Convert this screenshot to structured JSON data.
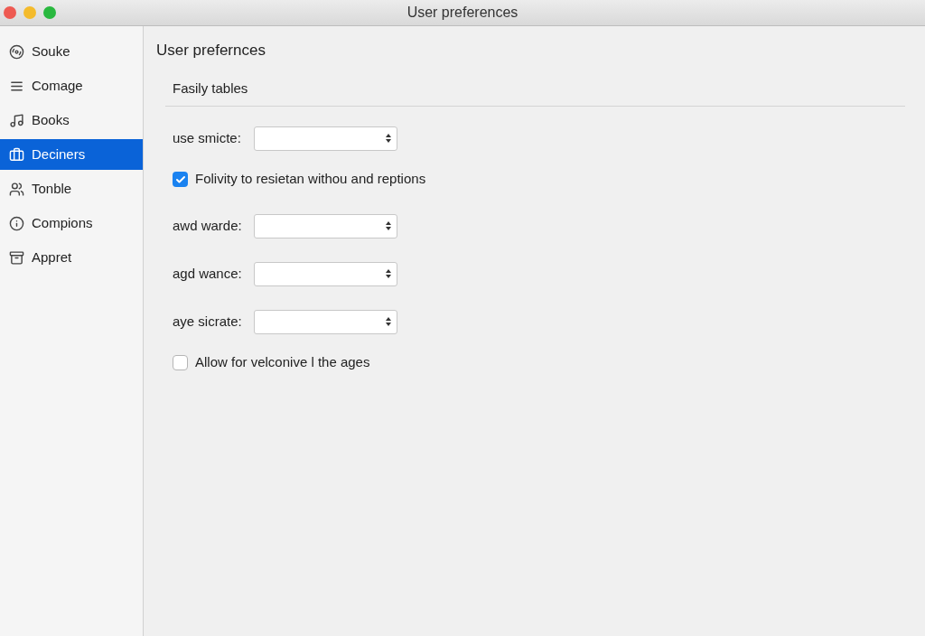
{
  "window": {
    "title": "User preferences"
  },
  "sidebar": {
    "items": [
      {
        "label": "Souke",
        "selected": false
      },
      {
        "label": "Comage",
        "selected": false
      },
      {
        "label": "Books",
        "selected": false
      },
      {
        "label": "Deciners",
        "selected": true
      },
      {
        "label": "Tonble",
        "selected": false
      },
      {
        "label": "Compions",
        "selected": false
      },
      {
        "label": "Appret",
        "selected": false
      }
    ]
  },
  "content": {
    "title": "User prefernces",
    "section": "Fasily tables",
    "rows": [
      {
        "kind": "select",
        "label": "use smicte:"
      },
      {
        "kind": "checkbox",
        "label": "Folivity to resietan withou and reptions",
        "checked": true
      },
      {
        "kind": "select",
        "label": "awd warde:"
      },
      {
        "kind": "select",
        "label": "agd wance:"
      },
      {
        "kind": "select",
        "label": "aye sicrate:"
      },
      {
        "kind": "checkbox",
        "label": "Allow for velconive l the ages",
        "checked": false
      }
    ]
  }
}
